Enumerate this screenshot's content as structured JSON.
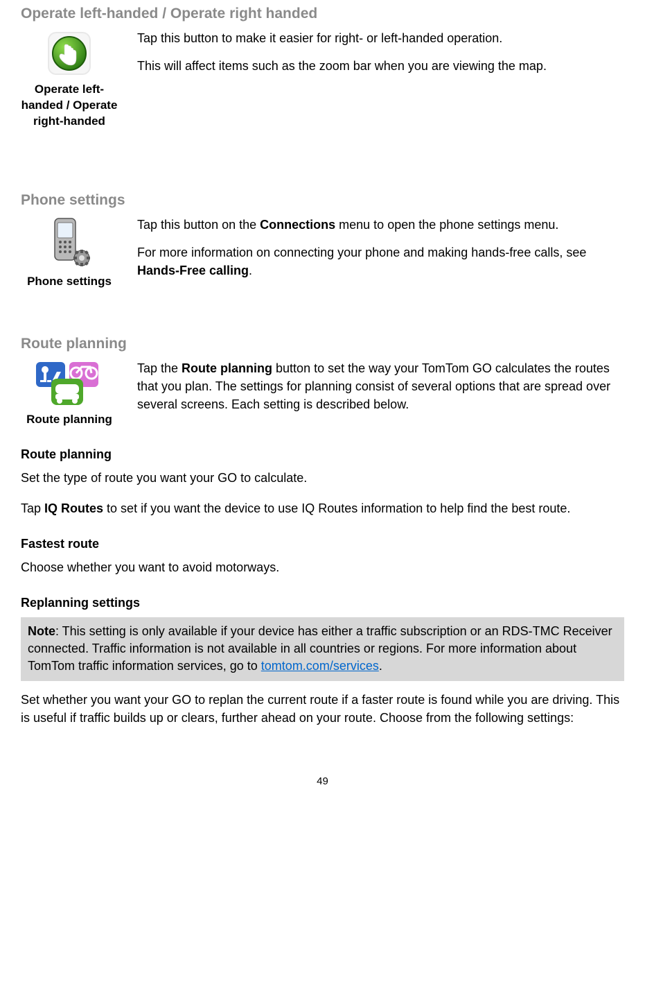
{
  "section1": {
    "title": "Operate left-handed / Operate right handed",
    "icon_label": "Operate left-handed / Operate right-handed",
    "p1": "Tap this button to make it easier for right- or left-handed operation.",
    "p2": "This will affect items such as the zoom bar when you are viewing the map."
  },
  "section2": {
    "title": "Phone settings",
    "icon_label": "Phone settings",
    "p1_a": "Tap this button on the ",
    "p1_bold": "Connections",
    "p1_b": " menu to open the phone settings menu.",
    "p2_a": "For more information on connecting your phone and making hands-free calls, see ",
    "p2_bold": "Hands-Free calling",
    "p2_b": "."
  },
  "section3": {
    "title": "Route planning",
    "icon_label": "Route planning",
    "p1_a": "Tap the ",
    "p1_bold": "Route planning",
    "p1_b": " button to set the way your TomTom GO calculates the routes that you plan. The settings for planning consist of several options that are spread over several screens. Each setting is described below.",
    "sub1_title": "Route planning",
    "sub1_p1": "Set the type of route you want your GO to calculate.",
    "sub1_p2_a": "Tap ",
    "sub1_p2_bold": "IQ Routes",
    "sub1_p2_b": " to set if you want the device to use IQ Routes information to help find the best route.",
    "sub2_title": "Fastest route",
    "sub2_p1": "Choose whether you want to avoid motorways.",
    "sub3_title": "Replanning settings",
    "note_bold": "Note",
    "note_text_a": ": This setting is only available if your device has either a traffic subscription or an RDS-TMC Receiver connected. Traffic information is not available in all countries or regions. For more information about TomTom traffic information services, go to ",
    "note_link": "tomtom.com/services",
    "note_text_b": ".",
    "sub3_p1": "Set whether you want your GO to replan the current route if a faster route is found while you are driving. This is useful if traffic builds up or clears, further ahead on your route. Choose from the following settings:"
  },
  "page_number": "49"
}
